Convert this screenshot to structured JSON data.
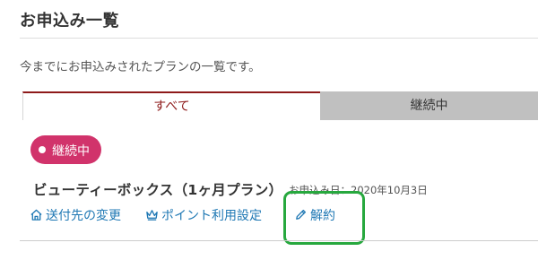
{
  "page": {
    "title": "お申込み一覧",
    "description": "今までにお申込みされたプランの一覧です。"
  },
  "tabs": [
    {
      "label": "すべて",
      "selected": true
    },
    {
      "label": "継続中",
      "selected": false
    }
  ],
  "subscription": {
    "status_badge": "継続中",
    "plan_name": "ビューティーボックス（1ヶ月プラン）",
    "apply_date": "お申込み日：2020年10月3日",
    "actions": [
      {
        "label": "送付先の変更",
        "icon": "home-icon"
      },
      {
        "label": "ポイント利用設定",
        "icon": "crown-icon"
      },
      {
        "label": "解約",
        "icon": "pencil-icon"
      }
    ]
  },
  "colors": {
    "accent": "#8e1a1a",
    "badge": "#d1336b",
    "link": "#1f78b4",
    "highlight": "#27a83e",
    "inactive_tab": "#c0c0c0"
  }
}
